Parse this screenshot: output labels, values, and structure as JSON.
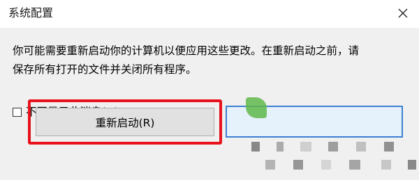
{
  "window": {
    "title": "系统配置",
    "close_icon": "close-icon"
  },
  "message": {
    "line1": "你可能需要重新启动你的计算机以便应用这些更改。在重新启动之前，请",
    "line2": "保存所有打开的文件并关闭所有程序。"
  },
  "checkbox": {
    "label": "不再显示此消息(D)。",
    "checked": false
  },
  "buttons": {
    "restart_label": "重新启动(R)",
    "secondary_label": ""
  },
  "colors": {
    "highlight": "#e8121d",
    "focus_border": "#3c7fd4",
    "body_bg": "#f0f0f0",
    "button_bg": "#e1e1e1"
  }
}
